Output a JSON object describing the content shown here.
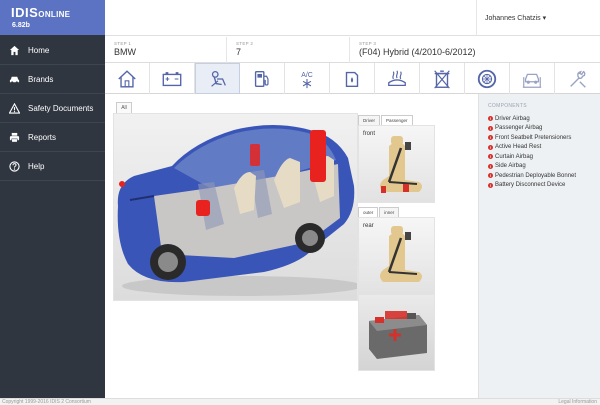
{
  "app": {
    "logo_main": "IDIS",
    "logo_small": "ONLINE",
    "version": "6.82b"
  },
  "sidebar": {
    "items": [
      {
        "label": "Home",
        "icon": "home-icon"
      },
      {
        "label": "Brands",
        "icon": "car-icon"
      },
      {
        "label": "Safety Documents",
        "icon": "warning-icon"
      },
      {
        "label": "Reports",
        "icon": "print-icon"
      },
      {
        "label": "Help",
        "icon": "help-icon"
      }
    ]
  },
  "user": {
    "name": "Johannes Chatzis ▾"
  },
  "steps": [
    {
      "label": "STEP 1",
      "value": "BMW"
    },
    {
      "label": "STEP 2",
      "value": "7"
    },
    {
      "label": "STEP 3",
      "value": "(F04) Hybrid (4/2010-6/2012)"
    }
  ],
  "toolbar": {
    "items": [
      {
        "icon": "house-icon"
      },
      {
        "icon": "battery-icon"
      },
      {
        "icon": "airbag-tools-icon",
        "active": true
      },
      {
        "icon": "fuel-pump-icon"
      },
      {
        "icon": "air-conditioning-icon",
        "text": "A/C"
      },
      {
        "icon": "fuel-tank-icon"
      },
      {
        "icon": "heated-window-icon"
      },
      {
        "icon": "recycling-bin-icon"
      },
      {
        "icon": "tire-icon"
      },
      {
        "icon": "lift-icon"
      },
      {
        "icon": "wrench-icon"
      }
    ]
  },
  "main": {
    "tab_all": "All",
    "front_panel": {
      "tabs": [
        "Driver",
        "Passenger"
      ],
      "caption": "front"
    },
    "rear_panel": {
      "tabs": [
        "outer",
        "inner"
      ],
      "caption": "rear"
    }
  },
  "components": {
    "heading": "COMPONENTS",
    "items": [
      "Driver Airbag",
      "Passenger Airbag",
      "Front Seatbelt Pretensioners",
      "Active Head Rest",
      "Curtain Airbag",
      "Side Airbag",
      "Pedestrian Deployable Bonnet",
      "Battery Disconnect Device"
    ]
  },
  "footer": {
    "copyright": "Copyright 1999-2016 IDIS 2 Consortium",
    "legal": "Legal Information"
  },
  "colors": {
    "sidebar": "#2f3640",
    "logo": "#5b73c2",
    "accent_red": "#d6302a",
    "icon_blue": "#5566a8"
  }
}
